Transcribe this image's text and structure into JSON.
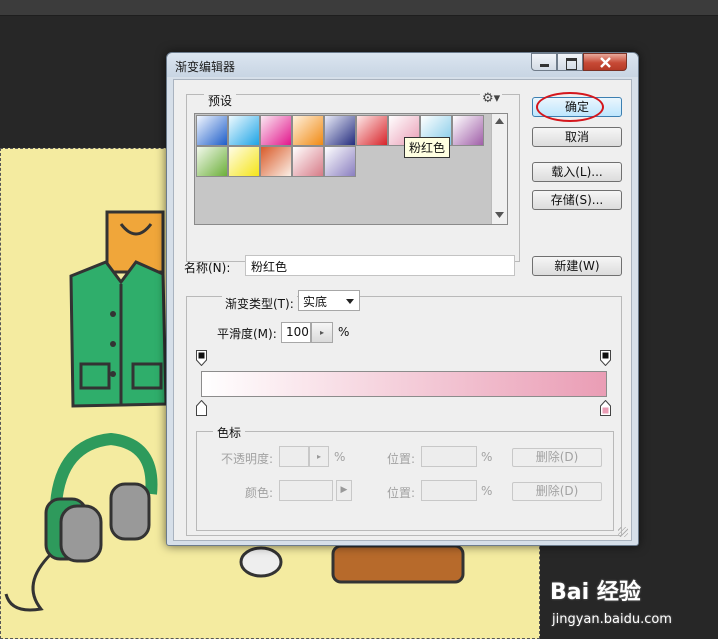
{
  "dialog": {
    "title": "渐变编辑器",
    "presets_label": "预设",
    "presets_menu_icon": "gear-icon",
    "tooltip": "粉红色",
    "swatches": [
      {
        "name": "blue",
        "from": "#f2f7ff",
        "to": "#1e5ec9"
      },
      {
        "name": "cyan",
        "from": "#eefaff",
        "to": "#1ea4e6"
      },
      {
        "name": "magenta",
        "from": "#fbe9f3",
        "to": "#e2168c"
      },
      {
        "name": "orange",
        "from": "#fff1dd",
        "to": "#f08a14"
      },
      {
        "name": "navy",
        "from": "#e9ebf8",
        "to": "#242c7e"
      },
      {
        "name": "red",
        "from": "#fde8e8",
        "to": "#d8242a"
      },
      {
        "name": "pink",
        "from": "#ffffff",
        "to": "#ea9db5"
      },
      {
        "name": "lightblue",
        "from": "#ffffff",
        "to": "#80c9e8"
      },
      {
        "name": "purple",
        "from": "#ffffff",
        "to": "#a05fa8"
      },
      {
        "name": "green",
        "from": "#f3f9ec",
        "to": "#6caf3a"
      },
      {
        "name": "yellow",
        "from": "#fffde6",
        "to": "#f5e418"
      },
      {
        "name": "peach",
        "from": "#d95b2a",
        "to": "#fbefe6"
      },
      {
        "name": "rose",
        "from": "#ffffff",
        "to": "#d77b87"
      },
      {
        "name": "lavender",
        "from": "#ffffff",
        "to": "#8a7fc0"
      }
    ],
    "ok_label": "确定",
    "cancel_label": "取消",
    "load_label": "载入(L)...",
    "save_label": "存储(S)...",
    "name_label": "名称(N):",
    "name_value": "粉红色",
    "new_label": "新建(W)",
    "type_label": "渐变类型(T):",
    "type_value": "实底",
    "smooth_label": "平滑度(M):",
    "smooth_value": "100",
    "smooth_unit": "%",
    "gradient": {
      "start": "#ffffff",
      "end": "#ea9db5"
    },
    "stops_label": "色标",
    "opacity_label": "不透明度:",
    "opacity_unit": "%",
    "location_label": "位置:",
    "location_unit": "%",
    "color_label": "颜色:",
    "delete_label": "删除(D)"
  },
  "watermark": {
    "logo": "Bai 经验",
    "url": "jingyan.baidu.com"
  },
  "colors": {
    "canvas": "#f4eba0",
    "accent_ok": "#3c7fb1",
    "highlight_circle": "#d4161c"
  }
}
